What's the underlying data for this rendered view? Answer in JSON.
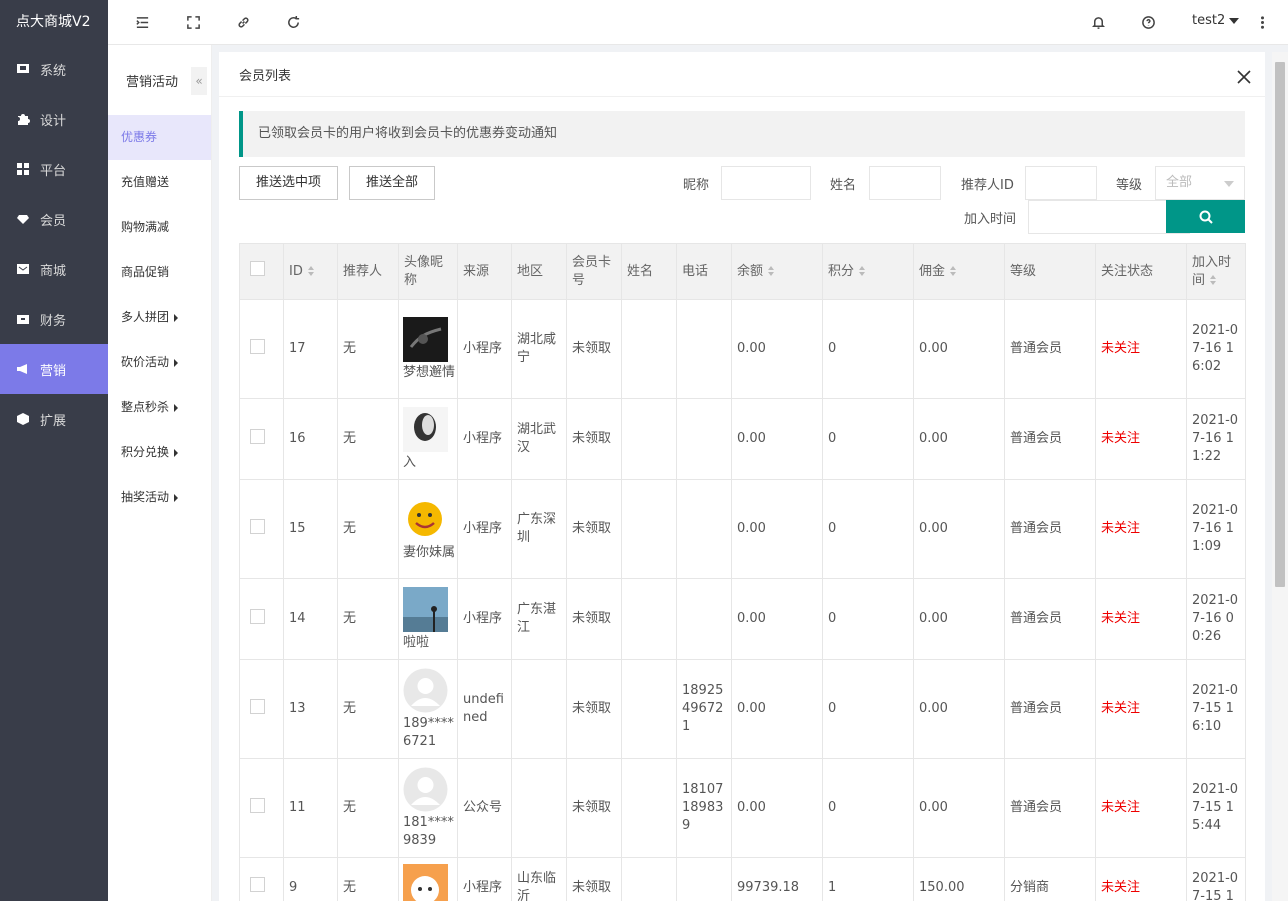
{
  "app": {
    "title": "点大商城V2"
  },
  "nav": [
    {
      "label": "系统",
      "icon": "monitor-icon"
    },
    {
      "label": "设计",
      "icon": "puzzle-icon"
    },
    {
      "label": "平台",
      "icon": "grid-icon"
    },
    {
      "label": "会员",
      "icon": "diamond-icon"
    },
    {
      "label": "商城",
      "icon": "mail-icon"
    },
    {
      "label": "财务",
      "icon": "wallet-icon"
    },
    {
      "label": "营销",
      "icon": "megaphone-icon"
    },
    {
      "label": "扩展",
      "icon": "cube-icon"
    }
  ],
  "user": {
    "name": "test2"
  },
  "subnav": {
    "title": "营销活动",
    "collapse": "«",
    "items": [
      {
        "label": "优惠券"
      },
      {
        "label": "充值赠送"
      },
      {
        "label": "购物满减"
      },
      {
        "label": "商品促销"
      },
      {
        "label": "多人拼团"
      },
      {
        "label": "砍价活动"
      },
      {
        "label": "整点秒杀"
      },
      {
        "label": "积分兑换"
      },
      {
        "label": "抽奖活动"
      }
    ]
  },
  "panel": {
    "title": "会员列表"
  },
  "notice": "已领取会员卡的用户将收到会员卡的优惠券变动通知",
  "buttons": {
    "push_selected": "推送选中项",
    "push_all": "推送全部"
  },
  "filters": {
    "nickname": "昵称",
    "name": "姓名",
    "referrer_id": "推荐人ID",
    "level": "等级",
    "level_placeholder": "全部",
    "join_time": "加入时间"
  },
  "table": {
    "headers": [
      "ID",
      "推荐人",
      "头像昵称",
      "来源",
      "地区",
      "会员卡号",
      "姓名",
      "电话",
      "余额",
      "积分",
      "佣金",
      "等级",
      "关注状态",
      "加入时间"
    ],
    "rows": [
      {
        "id": "17",
        "ref": "无",
        "nick": "梦想邂情",
        "src": "小程序",
        "region": "湖北咸宁",
        "card": "未领取",
        "name": "",
        "phone": "",
        "balance": "0.00",
        "points": "0",
        "comm": "0.00",
        "level": "普通会员",
        "follow": "未关注",
        "time": "2021-07-16 16:02",
        "avatar": "dark"
      },
      {
        "id": "16",
        "ref": "无",
        "nick": "入",
        "src": "小程序",
        "region": "湖北武汉",
        "card": "未领取",
        "name": "",
        "phone": "",
        "balance": "0.00",
        "points": "0",
        "comm": "0.00",
        "level": "普通会员",
        "follow": "未关注",
        "time": "2021-07-16 11:22",
        "avatar": "head"
      },
      {
        "id": "15",
        "ref": "无",
        "nick": "妻你妹属",
        "src": "小程序",
        "region": "广东深圳",
        "card": "未领取",
        "name": "",
        "phone": "",
        "balance": "0.00",
        "points": "0",
        "comm": "0.00",
        "level": "普通会员",
        "follow": "未关注",
        "time": "2021-07-16 11:09",
        "avatar": "smile"
      },
      {
        "id": "14",
        "ref": "无",
        "nick": "啦啦",
        "src": "小程序",
        "region": "广东湛江",
        "card": "未领取",
        "name": "",
        "phone": "",
        "balance": "0.00",
        "points": "0",
        "comm": "0.00",
        "level": "普通会员",
        "follow": "未关注",
        "time": "2021-07-16 00:26",
        "avatar": "sky"
      },
      {
        "id": "13",
        "ref": "无",
        "nick": "189****6721",
        "src": "undefined",
        "region": "",
        "card": "未领取",
        "name": "",
        "phone": "18925496721",
        "balance": "0.00",
        "points": "0",
        "comm": "0.00",
        "level": "普通会员",
        "follow": "未关注",
        "time": "2021-07-15 16:10",
        "avatar": "default"
      },
      {
        "id": "11",
        "ref": "无",
        "nick": "181****9839",
        "src": "公众号",
        "region": "",
        "card": "未领取",
        "name": "",
        "phone": "18107189839",
        "balance": "0.00",
        "points": "0",
        "comm": "0.00",
        "level": "普通会员",
        "follow": "未关注",
        "time": "2021-07-15 15:44",
        "avatar": "default"
      },
      {
        "id": "9",
        "ref": "无",
        "nick": "",
        "src": "小程序",
        "region": "山东临沂",
        "card": "未领取",
        "name": "",
        "phone": "",
        "balance": "99739.18",
        "points": "1",
        "comm": "150.00",
        "level": "分销商",
        "follow": "未关注",
        "time": "2021-07-15 1",
        "avatar": "orange"
      }
    ]
  }
}
